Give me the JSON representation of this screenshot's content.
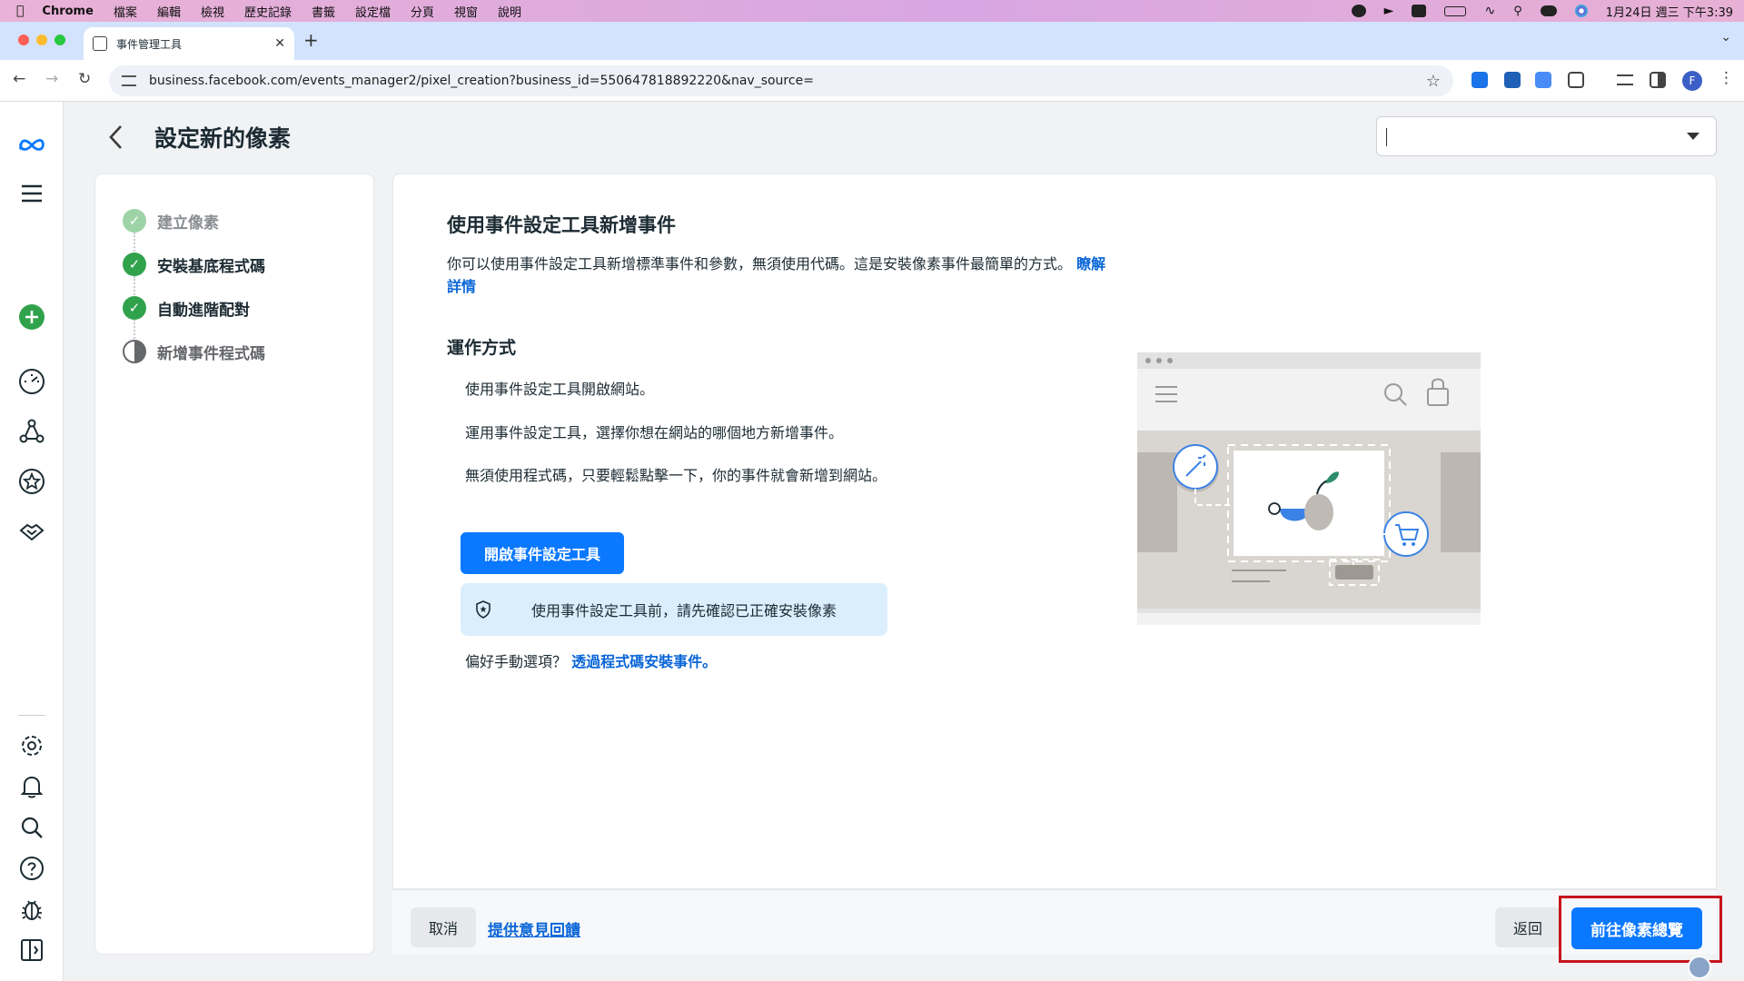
{
  "menubar": {
    "app": "Chrome",
    "items": [
      "檔案",
      "編輯",
      "檢視",
      "歷史記錄",
      "書籤",
      "設定檔",
      "分頁",
      "視窗",
      "說明"
    ],
    "datetime": "1月24日 週三 下午3:39"
  },
  "browser": {
    "tab_title": "事件管理工具",
    "url": "business.facebook.com/events_manager2/pixel_creation?business_id=550647818892220&nav_source=",
    "profile_initial": "F"
  },
  "header": {
    "title": "設定新的像素"
  },
  "steps": [
    {
      "label": "建立像素",
      "state": "done-faded"
    },
    {
      "label": "安裝基底程式碼",
      "state": "done"
    },
    {
      "label": "自動進階配對",
      "state": "done"
    },
    {
      "label": "新增事件程式碼",
      "state": "in-progress"
    }
  ],
  "content": {
    "heading": "使用事件設定工具新增事件",
    "intro": "你可以使用事件設定工具新增標準事件和參數，無須使用代碼。這是安裝像素事件最簡單的方式。",
    "learn_more": "瞭解詳情",
    "how_heading": "運作方式",
    "how_steps": [
      "使用事件設定工具開啟網站。",
      "運用事件設定工具，選擇你想在網站的哪個地方新增事件。",
      "無須使用程式碼，只要輕鬆點擊一下，你的事件就會新增到網站。"
    ],
    "open_button": "開啟事件設定工具",
    "notice": "使用事件設定工具前，請先確認已正確安裝像素",
    "manual_prefix": "偏好手動選項？",
    "manual_link": "透過程式碼安裝事件。"
  },
  "footer": {
    "cancel": "取消",
    "feedback": "提供意見回饋",
    "back": "返回",
    "primary": "前往像素總覽"
  },
  "colors": {
    "primary_blue": "#0a78ff",
    "success_green": "#31a24c",
    "highlight_red": "#c8141c"
  }
}
